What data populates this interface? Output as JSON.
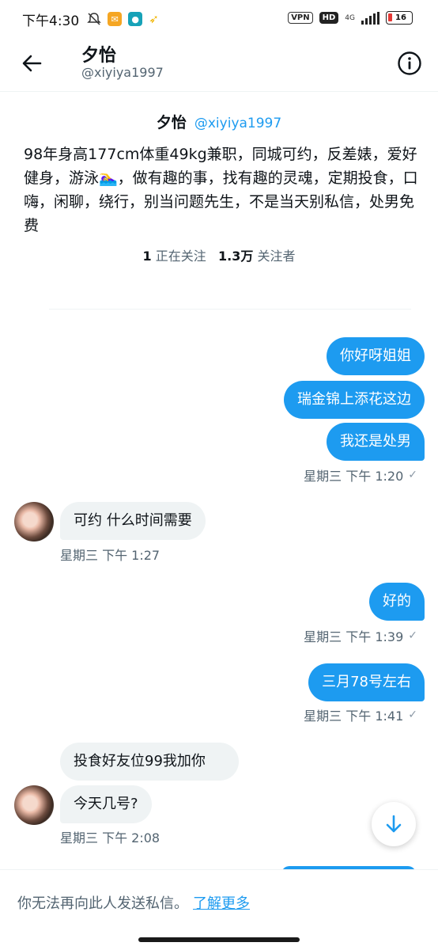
{
  "status_bar": {
    "time": "下午4:30",
    "vpn": "VPN",
    "hd": "HD",
    "network": "4G",
    "battery": "16"
  },
  "header": {
    "name": "夕怡",
    "handle": "@xiyiya1997"
  },
  "profile": {
    "name": "夕怡",
    "handle": "@xiyiya1997",
    "bio": "98年身高177cm体重49kg兼职，同城可约，反差婊，爱好健身，游泳🏊‍♀️，做有趣的事，找有趣的灵魂，定期投食，口嗨，闲聊，绕行，别当问题先生，不是当天别私信，处男免费",
    "following_count": "1",
    "following_label": "正在关注",
    "followers_count": "1.3万",
    "followers_label": "关注者"
  },
  "messages": [
    {
      "dir": "out",
      "text": "你好呀姐姐"
    },
    {
      "dir": "out",
      "text": "瑞金锦上添花这边"
    },
    {
      "dir": "out",
      "text": "我还是处男"
    },
    {
      "dir": "meta",
      "text": "星期三 下午 1:20"
    },
    {
      "dir": "in",
      "text": "可约 什么时间需要"
    },
    {
      "dir": "meta",
      "text": "星期三 下午 1:27"
    },
    {
      "dir": "out",
      "text": "好的"
    },
    {
      "dir": "meta",
      "text": "星期三 下午 1:39"
    },
    {
      "dir": "out",
      "text": "三月78号左右"
    },
    {
      "dir": "meta",
      "text": "星期三 下午 1:41"
    },
    {
      "dir": "in",
      "text": "投食好友位99我加你"
    },
    {
      "dir": "in",
      "text": "今天几号?"
    },
    {
      "dir": "meta",
      "text": "星期三 下午 2:08"
    }
  ],
  "bottom": {
    "notice": "你无法再向此人发送私信。",
    "learn_more": "了解更多"
  },
  "colors": {
    "accent": "#1d9bf0",
    "incoming_bubble": "#eff3f4",
    "secondary_text": "#536471"
  },
  "icons": [
    "back-arrow-icon",
    "info-icon",
    "read-check-icon",
    "scroll-down-arrow-icon"
  ]
}
